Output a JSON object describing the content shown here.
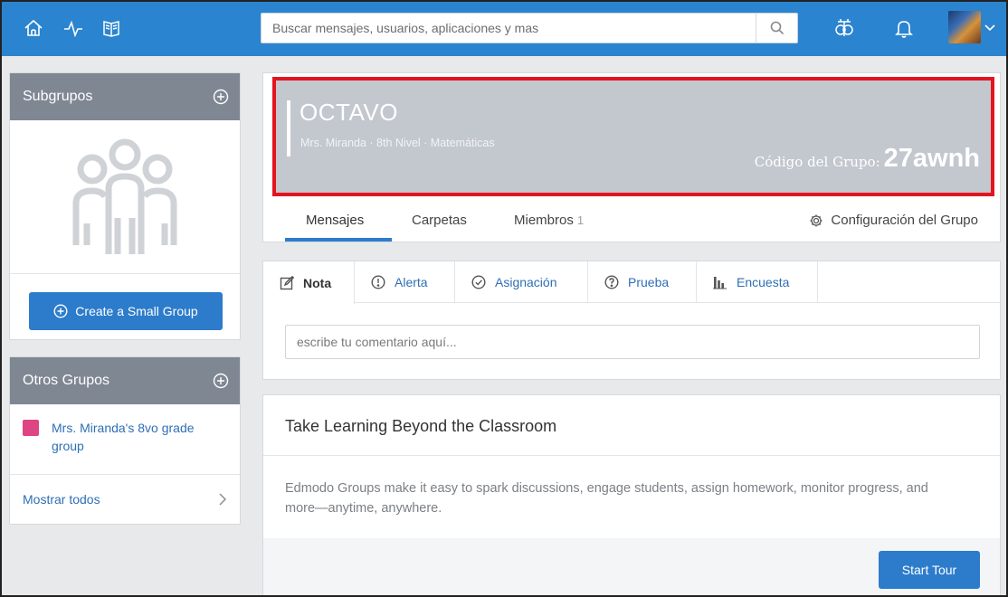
{
  "topbar": {
    "search_placeholder": "Buscar mensajes, usuarios, aplicaciones y mas",
    "icons": [
      "home-icon",
      "activity-icon",
      "book-icon",
      "search-icon",
      "backpack-icon",
      "bell-icon",
      "chevron-down-icon"
    ]
  },
  "sidebar": {
    "subgroups": {
      "title": "Subgrupos",
      "create_button": "Create a Small Group"
    },
    "other_groups": {
      "title": "Otros Grupos",
      "items": [
        {
          "name": "Mrs. Miranda's 8vo grade group",
          "color": "#dd4683"
        }
      ],
      "show_all": "Mostrar todos"
    }
  },
  "group": {
    "name": "OCTAVO",
    "subtitle": "Mrs. Miranda · 8th Nivel · Matemáticas",
    "code_label": "Código del Grupo:",
    "code": "27awnh",
    "tabs": [
      {
        "label": "Mensajes",
        "active": true
      },
      {
        "label": "Carpetas"
      },
      {
        "label": "Miembros",
        "count": "1"
      }
    ],
    "settings_label": "Configuración del Grupo"
  },
  "composer": {
    "tabs": [
      {
        "label": "Nota",
        "icon": "note-icon",
        "active": true
      },
      {
        "label": "Alerta",
        "icon": "alert-icon"
      },
      {
        "label": "Asignación",
        "icon": "check-circle-icon"
      },
      {
        "label": "Prueba",
        "icon": "question-icon"
      },
      {
        "label": "Encuesta",
        "icon": "poll-icon"
      }
    ],
    "comment_placeholder": "escribe tu comentario aquí..."
  },
  "promo": {
    "title": "Take Learning Beyond the Classroom",
    "text": "Edmodo Groups make it easy to spark discussions, engage students, assign homework, monitor progress, and more—anytime, anywhere.",
    "button": "Start Tour"
  },
  "colors": {
    "topbar": "#2b84cf",
    "accent": "#2d7ccb",
    "highlight_border": "#e3141f",
    "group_swatch": "#dd4683"
  }
}
